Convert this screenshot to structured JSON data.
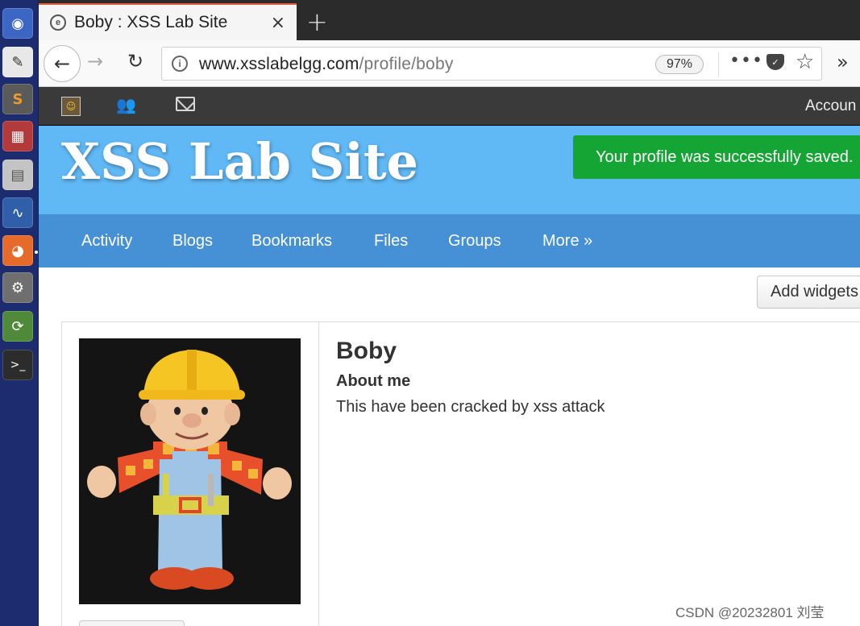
{
  "browser": {
    "tab_title": "Boby : XSS Lab Site",
    "tab_close": "×",
    "new_tab": "+",
    "url_host": "www.xsslabelgg.com",
    "url_path": "/profile/boby",
    "zoom": "97%"
  },
  "launcher": {
    "items": [
      "ubuntu-dash",
      "text-editor",
      "sublime-text",
      "ghex",
      "files",
      "wireshark",
      "firefox",
      "system-settings",
      "software-updater",
      "terminal"
    ]
  },
  "topbar": {
    "account_label": "Accoun"
  },
  "site": {
    "title": "XSS Lab Site",
    "flash_message": "Your profile was successfully saved.",
    "accent": "#60b8f5",
    "menu_color": "#4690d6",
    "flash_color": "#15a534"
  },
  "menu": {
    "items": [
      "Activity",
      "Blogs",
      "Bookmarks",
      "Files",
      "Groups",
      "More »"
    ]
  },
  "content": {
    "add_widgets_label": "Add widgets",
    "profile_name": "Boby",
    "about_label": "About me",
    "about_text": "This have been cracked by xss attack"
  },
  "watermark": "CSDN @20232801 刘莹"
}
